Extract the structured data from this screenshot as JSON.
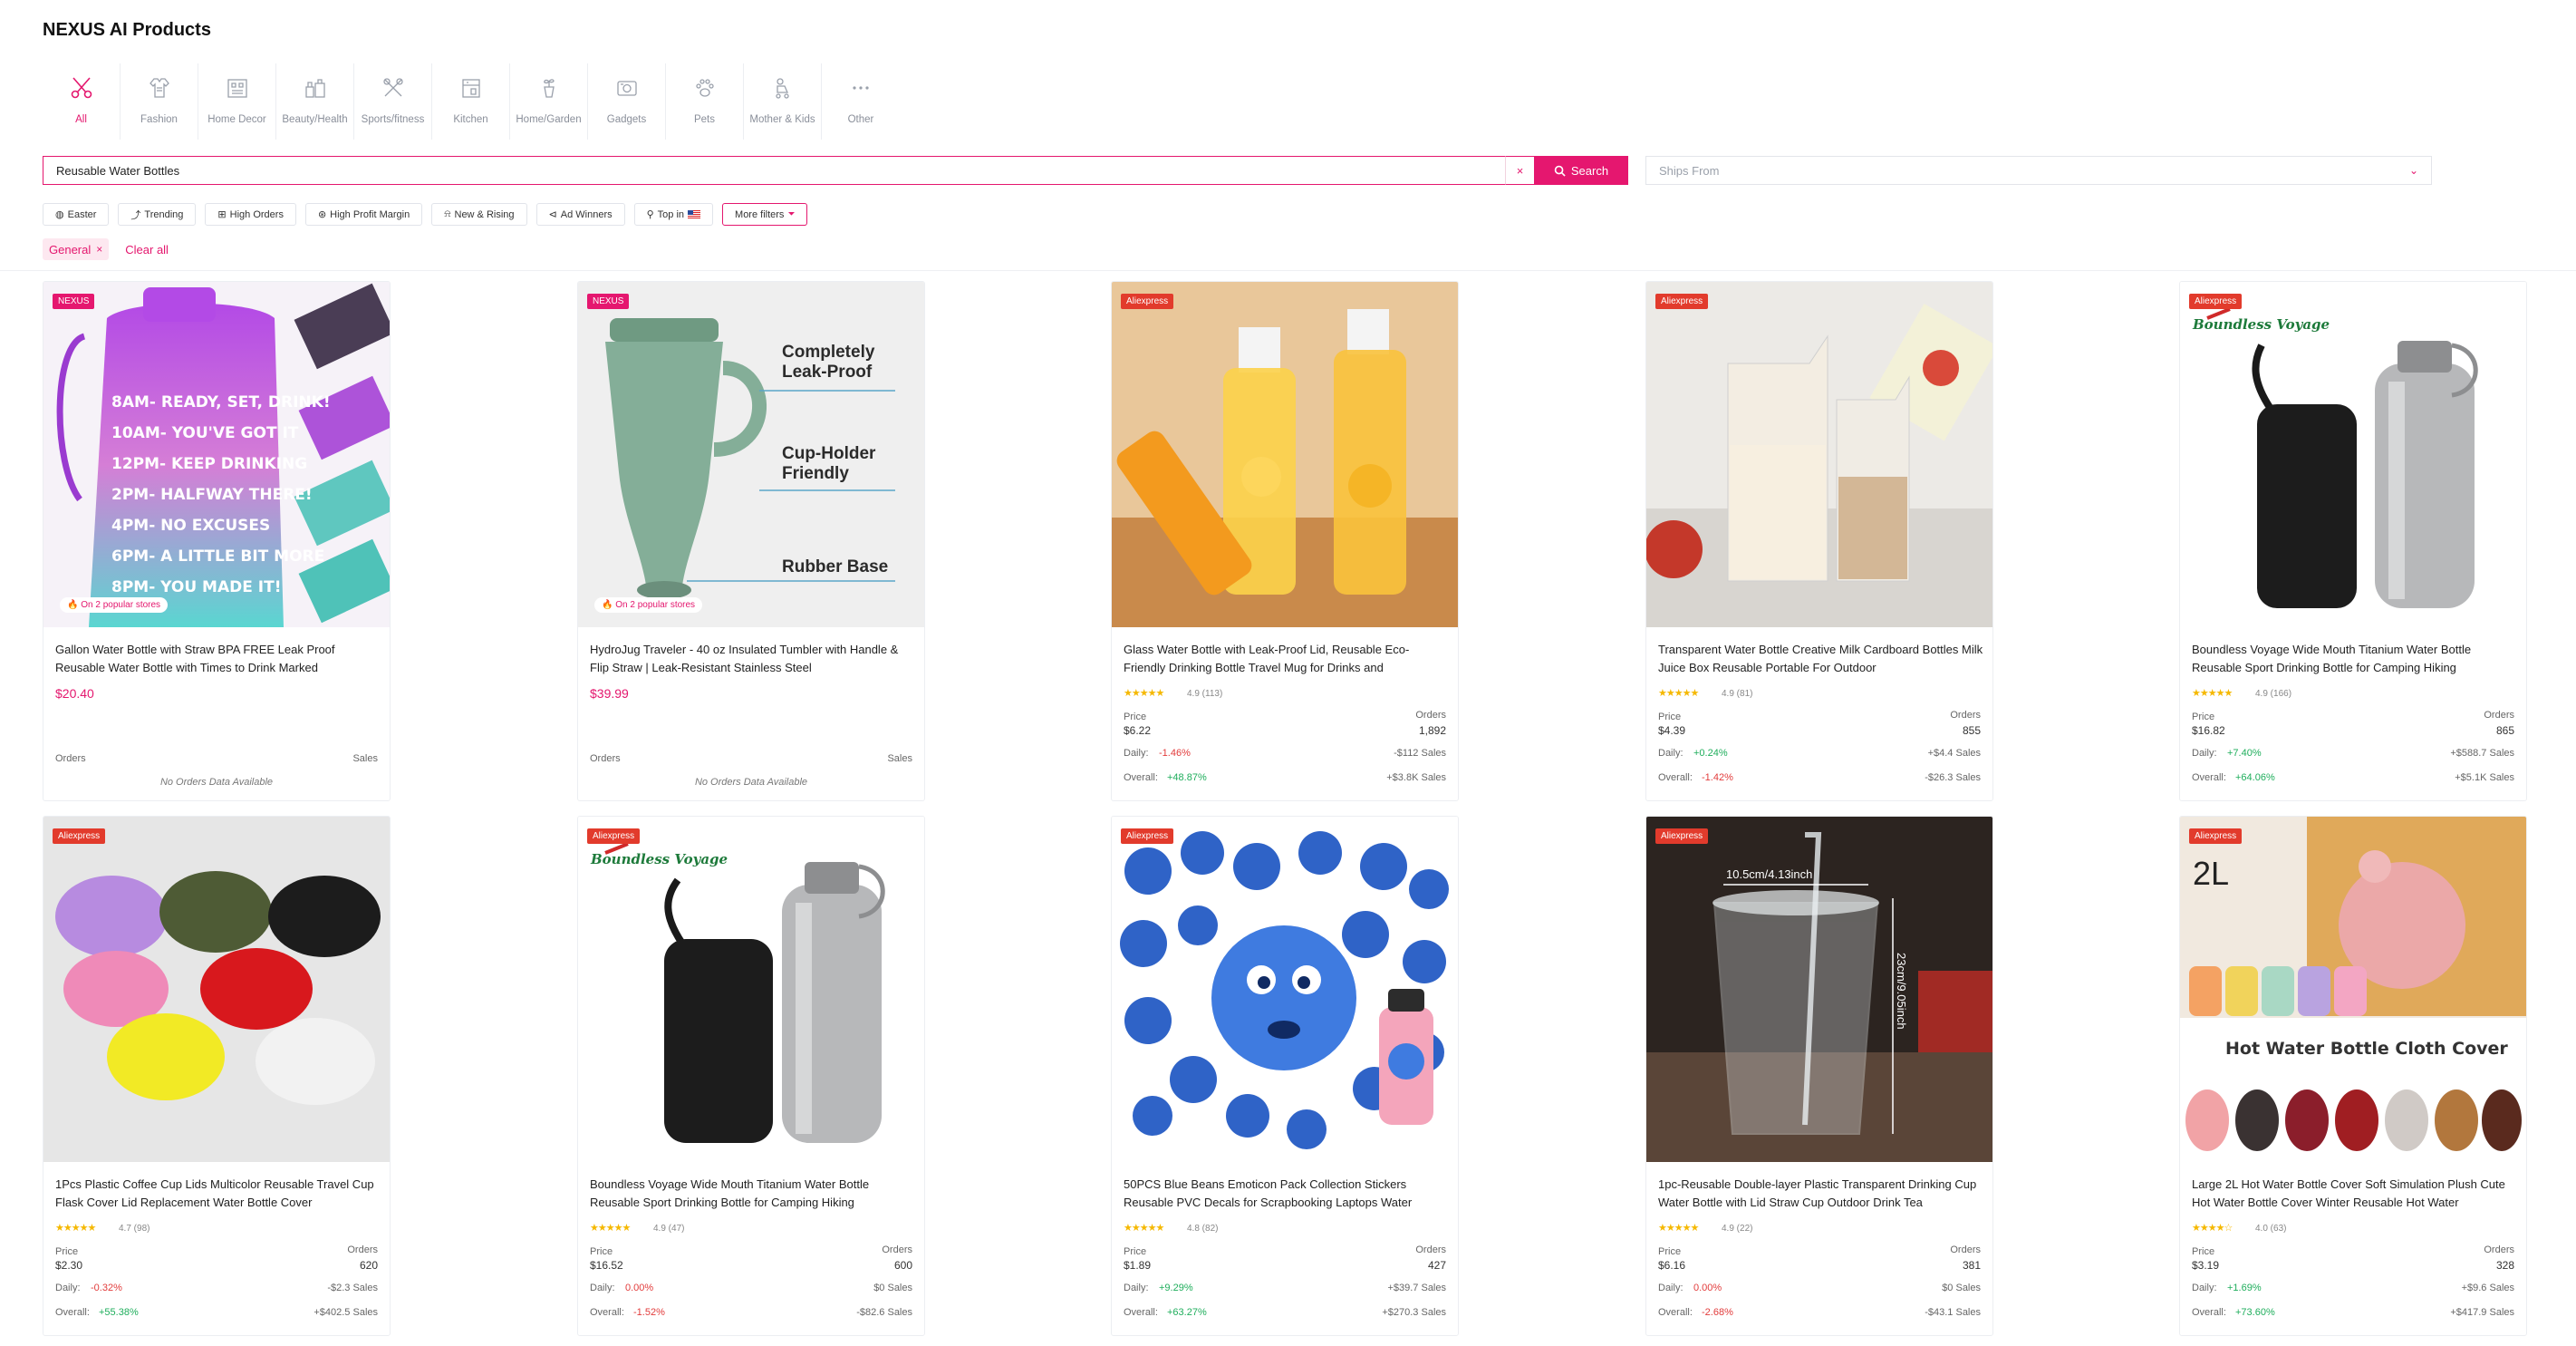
{
  "app": {
    "title": "NEXUS AI Products"
  },
  "categories": [
    {
      "label": "All",
      "icon": "scissors-icon",
      "active": true
    },
    {
      "label": "Fashion",
      "icon": "fashion-icon"
    },
    {
      "label": "Home Decor",
      "icon": "home-decor-icon"
    },
    {
      "label": "Beauty/Health",
      "icon": "beauty-icon"
    },
    {
      "label": "Sports/fitness",
      "icon": "sports-icon"
    },
    {
      "label": "Kitchen",
      "icon": "kitchen-icon"
    },
    {
      "label": "Home/Garden",
      "icon": "garden-icon"
    },
    {
      "label": "Gadgets",
      "icon": "gadgets-icon"
    },
    {
      "label": "Pets",
      "icon": "paw-icon"
    },
    {
      "label": "Mother & Kids",
      "icon": "stroller-icon"
    },
    {
      "label": "Other",
      "icon": "more-icon"
    }
  ],
  "search": {
    "value": "Reusable Water Bottles",
    "clear_label": "×",
    "button_label": "Search"
  },
  "ships_from": {
    "placeholder": "Ships From"
  },
  "filters": {
    "easter": "Easter",
    "trending": "Trending",
    "high_orders": "High Orders",
    "high_profit": "High Profit Margin",
    "new_rising": "New & Rising",
    "ad_winners": "Ad Winners",
    "top_in": "Top in",
    "more": "More filters"
  },
  "active_filters": {
    "tag": "General",
    "clear_all": "Clear all"
  },
  "labels": {
    "price": "Price",
    "orders": "Orders",
    "sales": "Sales",
    "daily": "Daily:",
    "overall": "Overall:",
    "no_orders": "No Orders Data Available",
    "popular": "On 2 popular stores"
  },
  "products": [
    {
      "badge": "NEXUS",
      "title": "Gallon Water Bottle with Straw BPA FREE Leak Proof Reusable Water Bottle with Times to Drink Marked",
      "price": "$20.40"
    },
    {
      "badge": "NEXUS",
      "title": "HydroJug Traveler - 40 oz Insulated Tumbler with Handle & Flip Straw | Leak-Resistant Stainless Steel",
      "price": "$39.99"
    },
    {
      "badge": "Aliexpress",
      "title": "Glass Water Bottle with Leak-Proof Lid, Reusable Eco-Friendly Drinking Bottle Travel Mug for Drinks and",
      "stars": "★★★★★",
      "rating": "4.9 (113)",
      "price": "$6.22",
      "orders": "1,892",
      "daily": "-1.46%",
      "daily_sales": "-$112 Sales",
      "overall": "+48.87%",
      "overall_sales": "+$3.8K Sales"
    },
    {
      "badge": "Aliexpress",
      "title": "Transparent Water Bottle Creative Milk Cardboard Bottles Milk Juice Box Reusable Portable For Outdoor",
      "stars": "★★★★★",
      "rating": "4.9 (81)",
      "price": "$4.39",
      "orders": "855",
      "daily": "+0.24%",
      "daily_sales": "+$4.4 Sales",
      "overall": "-1.42%",
      "overall_sales": "-$26.3 Sales"
    },
    {
      "badge": "Aliexpress",
      "title": "Boundless Voyage Wide Mouth Titanium Water Bottle Reusable Sport Drinking Bottle for Camping Hiking",
      "stars": "★★★★★",
      "rating": "4.9 (166)",
      "price": "$16.82",
      "orders": "865",
      "daily": "+7.40%",
      "daily_sales": "+$588.7 Sales",
      "overall": "+64.06%",
      "overall_sales": "+$5.1K Sales"
    },
    {
      "badge": "Aliexpress",
      "title": "1Pcs Plastic Coffee Cup Lids Multicolor Reusable Travel Cup Flask Cover Lid Replacement Water Bottle Cover",
      "stars": "★★★★★",
      "rating": "4.7 (98)",
      "price": "$2.30",
      "orders": "620",
      "daily": "-0.32%",
      "daily_sales": "-$2.3 Sales",
      "overall": "+55.38%",
      "overall_sales": "+$402.5 Sales"
    },
    {
      "badge": "Aliexpress",
      "title": "Boundless Voyage Wide Mouth Titanium Water Bottle Reusable Sport Drinking Bottle for Camping Hiking",
      "stars": "★★★★★",
      "rating": "4.9 (47)",
      "price": "$16.52",
      "orders": "600",
      "daily": "0.00%",
      "daily_sales": "$0 Sales",
      "overall": "-1.52%",
      "overall_sales": "-$82.6 Sales"
    },
    {
      "badge": "Aliexpress",
      "title": "50PCS Blue Beans Emoticon Pack Collection Stickers Reusable PVC Decals for Scrapbooking Laptops Water",
      "stars": "★★★★★",
      "rating": "4.8 (82)",
      "price": "$1.89",
      "orders": "427",
      "daily": "+9.29%",
      "daily_sales": "+$39.7 Sales",
      "overall": "+63.27%",
      "overall_sales": "+$270.3 Sales"
    },
    {
      "badge": "Aliexpress",
      "title": "1pc-Reusable Double-layer Plastic Transparent Drinking Cup Water Bottle with Lid Straw Cup Outdoor Drink Tea",
      "stars": "★★★★★",
      "rating": "4.9 (22)",
      "price": "$6.16",
      "orders": "381",
      "daily": "0.00%",
      "daily_sales": "$0 Sales",
      "overall": "-2.68%",
      "overall_sales": "-$43.1 Sales"
    },
    {
      "badge": "Aliexpress",
      "title": "Large 2L Hot Water Bottle Cover Soft Simulation Plush Cute Hot Water Bottle Cover Winter Reusable Hot Water",
      "stars": "★★★★☆",
      "rating": "4.0 (63)",
      "price": "$3.19",
      "orders": "328",
      "daily": "+1.69%",
      "daily_sales": "+$9.6 Sales",
      "overall": "+73.60%",
      "overall_sales": "+$417.9 Sales"
    }
  ],
  "image_text": {
    "p1_lines": [
      "8AM- READY, SET, DRINK!",
      "10AM- YOU'VE GOT IT",
      "12PM- KEEP DRINKING",
      "2PM- HALFWAY THERE!",
      "4PM- NO EXCUSES",
      "6PM- A LITTLE BIT MORE",
      "8PM- YOU MADE IT!"
    ],
    "p2_line1": "Completely",
    "p2_line2": "Leak-Proof",
    "p2_line3": "Cup-Holder",
    "p2_line4": "Friendly",
    "p2_line5": "Rubber Base",
    "boundless": "Boundless Voyage",
    "size_label": "10.5cm/4.13inch",
    "height_label": "23cm/9.05inch",
    "two_l": "2L",
    "cover_title": "Hot Water Bottle Cloth Cover"
  },
  "colors": {
    "accent": "#e5176f",
    "positive": "#1fae5c",
    "negative": "#e23b3b",
    "ali_badge": "#e23b2c"
  }
}
